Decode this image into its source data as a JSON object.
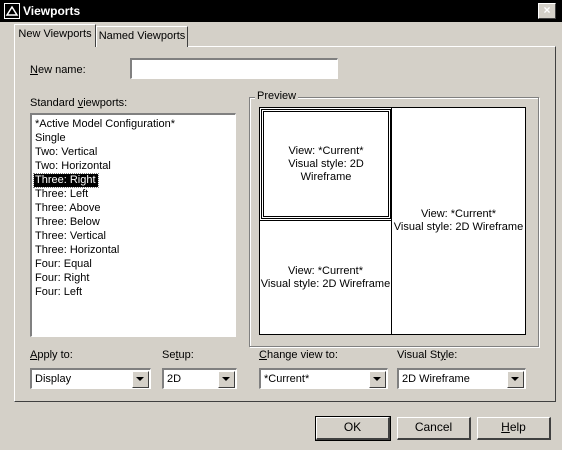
{
  "window": {
    "title": "Viewports",
    "close_symbol": "×"
  },
  "tabs": [
    {
      "label": "New Viewports",
      "active": true
    },
    {
      "label": "Named Viewports",
      "active": false
    }
  ],
  "new_name": {
    "label_access": "N",
    "label_rest": "ew name:",
    "value": ""
  },
  "standard_viewports": {
    "label_pre": "Standard ",
    "label_access": "v",
    "label_post": "iewports:",
    "items": [
      "*Active Model Configuration*",
      "Single",
      "Two:  Vertical",
      "Two:  Horizontal",
      "Three: Right",
      "Three: Left",
      "Three: Above",
      "Three: Below",
      "Three: Vertical",
      "Three: Horizontal",
      "Four:  Equal",
      "Four:  Right",
      "Four:  Left"
    ],
    "selected_index": 4
  },
  "preview": {
    "title": "Preview",
    "viewports": [
      {
        "view": "View: *Current*",
        "style": "Visual style: 2D Wireframe"
      },
      {
        "view": "View: *Current*",
        "style": "Visual style: 2D Wireframe"
      },
      {
        "view": "View: *Current*",
        "style": "Visual style: 2D Wireframe"
      }
    ]
  },
  "apply_to": {
    "label_access": "A",
    "label_rest": "pply to:",
    "value": "Display"
  },
  "setup": {
    "label_pre": "Se",
    "label_access": "t",
    "label_post": "up:",
    "value": "2D"
  },
  "change_view": {
    "label_access": "C",
    "label_rest": "hange view to:",
    "value": "*Current*"
  },
  "visual_style": {
    "label_pre": "Visual St",
    "label_access": "y",
    "label_post": "le:",
    "value": "2D Wireframe"
  },
  "buttons": {
    "ok": "OK",
    "cancel": "Cancel",
    "help_access": "H",
    "help_rest": "elp"
  }
}
